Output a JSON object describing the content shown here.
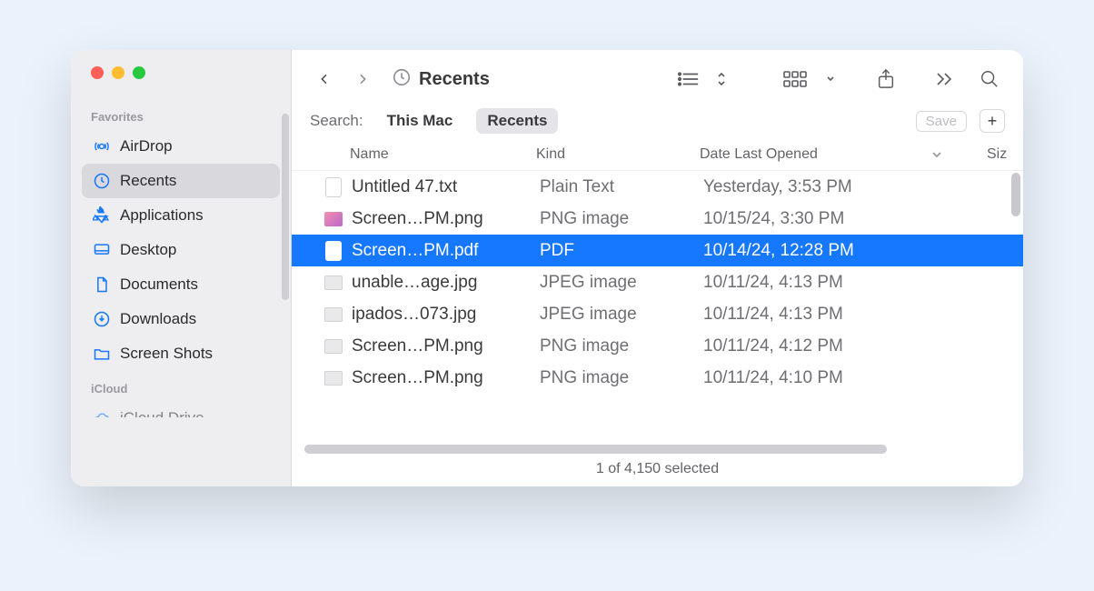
{
  "window": {
    "title": "Recents"
  },
  "sidebar": {
    "sections": [
      {
        "label": "Favorites",
        "items": [
          {
            "label": "AirDrop",
            "icon": "airdrop-icon"
          },
          {
            "label": "Recents",
            "icon": "clock-icon"
          },
          {
            "label": "Applications",
            "icon": "apps-icon"
          },
          {
            "label": "Desktop",
            "icon": "desktop-icon"
          },
          {
            "label": "Documents",
            "icon": "document-icon"
          },
          {
            "label": "Downloads",
            "icon": "download-icon"
          },
          {
            "label": "Screen Shots",
            "icon": "folder-icon"
          }
        ]
      },
      {
        "label": "iCloud",
        "items": [
          {
            "label": "iCloud Drive",
            "icon": "cloud-icon"
          }
        ]
      }
    ],
    "active_item": "Recents"
  },
  "search": {
    "label": "Search:",
    "scopes": [
      "This Mac",
      "Recents"
    ],
    "active_scope": "Recents",
    "save_label": "Save",
    "plus_label": "+"
  },
  "columns": {
    "name": "Name",
    "kind": "Kind",
    "date": "Date Last Opened",
    "size": "Siz"
  },
  "files": [
    {
      "name": "Untitled 47.txt",
      "kind": "Plain Text",
      "date": "Yesterday, 3:53 PM",
      "icon": "fi-doc",
      "selected": false
    },
    {
      "name": "Screen…PM.png",
      "kind": "PNG image",
      "date": "10/15/24, 3:30 PM",
      "icon": "fi-png",
      "selected": false
    },
    {
      "name": "Screen…PM.pdf",
      "kind": "PDF",
      "date": "10/14/24, 12:28 PM",
      "icon": "fi-pdf",
      "selected": true
    },
    {
      "name": "unable…age.jpg",
      "kind": "JPEG image",
      "date": "10/11/24, 4:13 PM",
      "icon": "fi-jpg",
      "selected": false
    },
    {
      "name": "ipados…073.jpg",
      "kind": "JPEG image",
      "date": "10/11/24, 4:13 PM",
      "icon": "fi-jpg",
      "selected": false
    },
    {
      "name": "Screen…PM.png",
      "kind": "PNG image",
      "date": "10/11/24, 4:12 PM",
      "icon": "fi-jpg",
      "selected": false
    },
    {
      "name": "Screen…PM.png",
      "kind": "PNG image",
      "date": "10/11/24, 4:10 PM",
      "icon": "fi-jpg",
      "selected": false
    }
  ],
  "status": "1 of 4,150 selected"
}
